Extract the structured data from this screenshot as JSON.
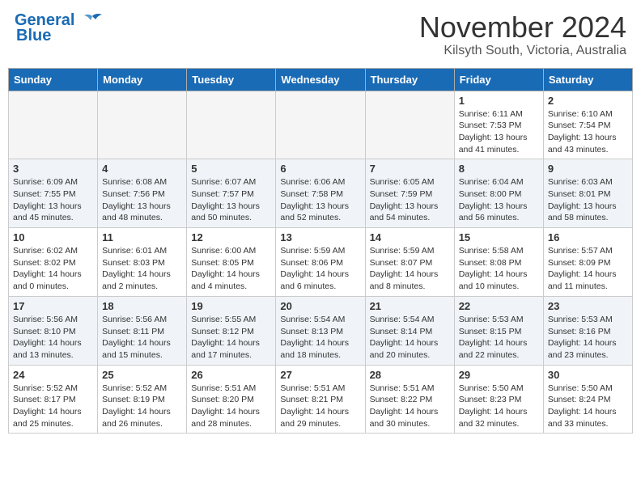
{
  "header": {
    "logo_line1": "General",
    "logo_line2": "Blue",
    "title": "November 2024",
    "subtitle": "Kilsyth South, Victoria, Australia"
  },
  "weekdays": [
    "Sunday",
    "Monday",
    "Tuesday",
    "Wednesday",
    "Thursday",
    "Friday",
    "Saturday"
  ],
  "weeks": [
    [
      {
        "day": "",
        "info": ""
      },
      {
        "day": "",
        "info": ""
      },
      {
        "day": "",
        "info": ""
      },
      {
        "day": "",
        "info": ""
      },
      {
        "day": "",
        "info": ""
      },
      {
        "day": "1",
        "info": "Sunrise: 6:11 AM\nSunset: 7:53 PM\nDaylight: 13 hours\nand 41 minutes."
      },
      {
        "day": "2",
        "info": "Sunrise: 6:10 AM\nSunset: 7:54 PM\nDaylight: 13 hours\nand 43 minutes."
      }
    ],
    [
      {
        "day": "3",
        "info": "Sunrise: 6:09 AM\nSunset: 7:55 PM\nDaylight: 13 hours\nand 45 minutes."
      },
      {
        "day": "4",
        "info": "Sunrise: 6:08 AM\nSunset: 7:56 PM\nDaylight: 13 hours\nand 48 minutes."
      },
      {
        "day": "5",
        "info": "Sunrise: 6:07 AM\nSunset: 7:57 PM\nDaylight: 13 hours\nand 50 minutes."
      },
      {
        "day": "6",
        "info": "Sunrise: 6:06 AM\nSunset: 7:58 PM\nDaylight: 13 hours\nand 52 minutes."
      },
      {
        "day": "7",
        "info": "Sunrise: 6:05 AM\nSunset: 7:59 PM\nDaylight: 13 hours\nand 54 minutes."
      },
      {
        "day": "8",
        "info": "Sunrise: 6:04 AM\nSunset: 8:00 PM\nDaylight: 13 hours\nand 56 minutes."
      },
      {
        "day": "9",
        "info": "Sunrise: 6:03 AM\nSunset: 8:01 PM\nDaylight: 13 hours\nand 58 minutes."
      }
    ],
    [
      {
        "day": "10",
        "info": "Sunrise: 6:02 AM\nSunset: 8:02 PM\nDaylight: 14 hours\nand 0 minutes."
      },
      {
        "day": "11",
        "info": "Sunrise: 6:01 AM\nSunset: 8:03 PM\nDaylight: 14 hours\nand 2 minutes."
      },
      {
        "day": "12",
        "info": "Sunrise: 6:00 AM\nSunset: 8:05 PM\nDaylight: 14 hours\nand 4 minutes."
      },
      {
        "day": "13",
        "info": "Sunrise: 5:59 AM\nSunset: 8:06 PM\nDaylight: 14 hours\nand 6 minutes."
      },
      {
        "day": "14",
        "info": "Sunrise: 5:59 AM\nSunset: 8:07 PM\nDaylight: 14 hours\nand 8 minutes."
      },
      {
        "day": "15",
        "info": "Sunrise: 5:58 AM\nSunset: 8:08 PM\nDaylight: 14 hours\nand 10 minutes."
      },
      {
        "day": "16",
        "info": "Sunrise: 5:57 AM\nSunset: 8:09 PM\nDaylight: 14 hours\nand 11 minutes."
      }
    ],
    [
      {
        "day": "17",
        "info": "Sunrise: 5:56 AM\nSunset: 8:10 PM\nDaylight: 14 hours\nand 13 minutes."
      },
      {
        "day": "18",
        "info": "Sunrise: 5:56 AM\nSunset: 8:11 PM\nDaylight: 14 hours\nand 15 minutes."
      },
      {
        "day": "19",
        "info": "Sunrise: 5:55 AM\nSunset: 8:12 PM\nDaylight: 14 hours\nand 17 minutes."
      },
      {
        "day": "20",
        "info": "Sunrise: 5:54 AM\nSunset: 8:13 PM\nDaylight: 14 hours\nand 18 minutes."
      },
      {
        "day": "21",
        "info": "Sunrise: 5:54 AM\nSunset: 8:14 PM\nDaylight: 14 hours\nand 20 minutes."
      },
      {
        "day": "22",
        "info": "Sunrise: 5:53 AM\nSunset: 8:15 PM\nDaylight: 14 hours\nand 22 minutes."
      },
      {
        "day": "23",
        "info": "Sunrise: 5:53 AM\nSunset: 8:16 PM\nDaylight: 14 hours\nand 23 minutes."
      }
    ],
    [
      {
        "day": "24",
        "info": "Sunrise: 5:52 AM\nSunset: 8:17 PM\nDaylight: 14 hours\nand 25 minutes."
      },
      {
        "day": "25",
        "info": "Sunrise: 5:52 AM\nSunset: 8:19 PM\nDaylight: 14 hours\nand 26 minutes."
      },
      {
        "day": "26",
        "info": "Sunrise: 5:51 AM\nSunset: 8:20 PM\nDaylight: 14 hours\nand 28 minutes."
      },
      {
        "day": "27",
        "info": "Sunrise: 5:51 AM\nSunset: 8:21 PM\nDaylight: 14 hours\nand 29 minutes."
      },
      {
        "day": "28",
        "info": "Sunrise: 5:51 AM\nSunset: 8:22 PM\nDaylight: 14 hours\nand 30 minutes."
      },
      {
        "day": "29",
        "info": "Sunrise: 5:50 AM\nSunset: 8:23 PM\nDaylight: 14 hours\nand 32 minutes."
      },
      {
        "day": "30",
        "info": "Sunrise: 5:50 AM\nSunset: 8:24 PM\nDaylight: 14 hours\nand 33 minutes."
      }
    ]
  ]
}
